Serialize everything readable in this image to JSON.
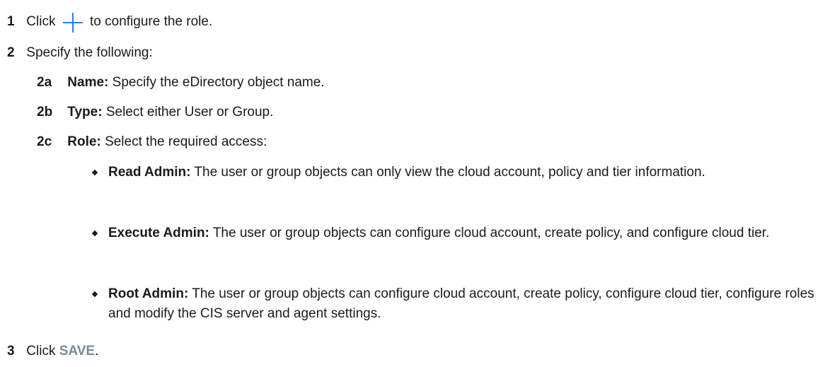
{
  "steps": [
    {
      "num": "1",
      "before": "Click",
      "after": "to configure the role.",
      "icon": "plus-icon"
    },
    {
      "num": "2",
      "text": "Specify the following:"
    },
    {
      "num": "3",
      "before": "Click",
      "save": "SAVE",
      "after": "."
    }
  ],
  "substeps": [
    {
      "num": "2a",
      "label": "Name:",
      "text": "Specify the eDirectory object name."
    },
    {
      "num": "2b",
      "label": "Type:",
      "text": "Select either User or Group."
    },
    {
      "num": "2c",
      "label": "Role:",
      "text": "Select the required access:"
    }
  ],
  "roles": [
    {
      "label": "Read Admin:",
      "text": "The user or group objects can only view the cloud account, policy and tier information."
    },
    {
      "label": "Execute Admin:",
      "text": "The user or group objects can configure cloud account, create policy, and configure cloud tier."
    },
    {
      "label": "Root Admin:",
      "text": "The user or group objects can configure cloud account, create policy, configure cloud tier, configure roles and modify the CIS server and agent settings."
    }
  ],
  "colors": {
    "plus_icon": "#2b7de9",
    "save_link": "#7a8a94"
  }
}
